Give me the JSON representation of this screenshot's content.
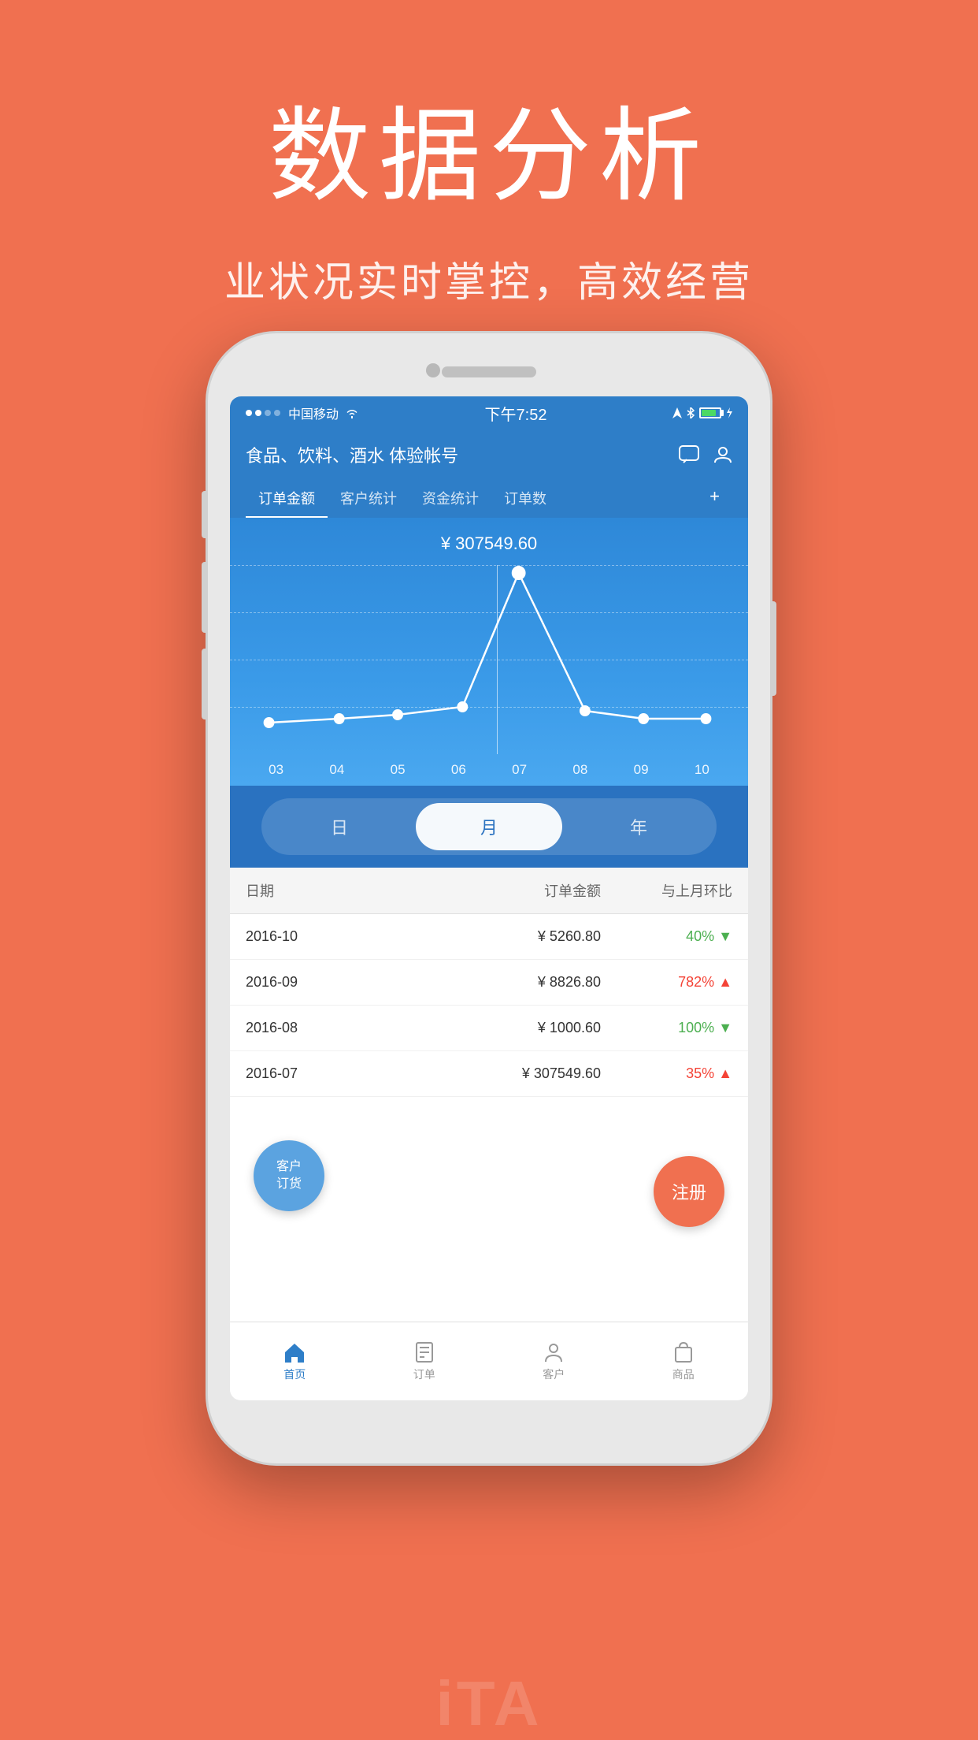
{
  "hero": {
    "title": "数据分析",
    "subtitle": "业状况实时掌控，高效经营"
  },
  "phone": {
    "status_bar": {
      "carrier": "中国移动",
      "time": "下午7:52",
      "wifi": true,
      "bluetooth": true,
      "battery": "75"
    },
    "header": {
      "title": "食品、饮料、酒水 体验帐号",
      "tabs": [
        "订单金额",
        "客户统计",
        "资金统计",
        "订单数"
      ]
    },
    "chart": {
      "current_value": "¥ 307549.60",
      "x_labels": [
        "03",
        "04",
        "05",
        "06",
        "07",
        "08",
        "09",
        "10"
      ],
      "active_x": "07"
    },
    "period": {
      "options": [
        "日",
        "月",
        "年"
      ],
      "active": "月"
    },
    "table": {
      "headers": [
        "日期",
        "订单金额",
        "与上月环比"
      ],
      "rows": [
        {
          "date": "2016-10",
          "amount": "¥ 5260.80",
          "change": "40%",
          "direction": "down"
        },
        {
          "date": "2016-09",
          "amount": "¥ 8826.80",
          "change": "782%",
          "direction": "up"
        },
        {
          "date": "2016-08",
          "amount": "¥ 1000.60",
          "change": "100%",
          "direction": "down"
        },
        {
          "date": "2016-07",
          "amount": "¥ 307549.60",
          "change": "35%",
          "direction": "up"
        }
      ]
    },
    "bottom_nav": {
      "items": [
        {
          "label": "首页",
          "active": true,
          "icon": "home"
        },
        {
          "label": "订单",
          "active": false,
          "icon": "order"
        },
        {
          "label": "客户",
          "active": false,
          "icon": "customer"
        },
        {
          "label": "商品",
          "active": false,
          "icon": "product"
        }
      ]
    },
    "fab": {
      "customer_label": "客户\n订货",
      "register_label": "注册"
    }
  },
  "watermark": "iTA"
}
